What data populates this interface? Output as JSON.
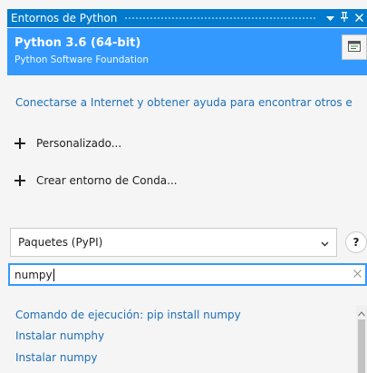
{
  "window": {
    "title": "Entornos de Python",
    "pin_glyph": "Ѩ",
    "menu_glyph": "▾",
    "close_glyph": "✕"
  },
  "environment": {
    "name": "Python 3.6 (64-bit)",
    "vendor": "Python Software Foundation",
    "open_icon": "console-window-icon"
  },
  "help_link": "Conectarse a Internet y obtener ayuda para encontrar otros e",
  "actions": [
    {
      "label": "Personalizado...",
      "icon": "plus-icon"
    },
    {
      "label": "Crear entorno de Conda...",
      "icon": "plus-icon"
    }
  ],
  "view_selector": {
    "selected": "Paquetes (PyPI)",
    "help_label": "?"
  },
  "search": {
    "value": "numpy",
    "clear_glyph": "✕"
  },
  "results": [
    "Comando de ejecución: pip install numpy",
    "Instalar numphy",
    "Instalar numpy"
  ],
  "colors": {
    "accent": "#007acc",
    "selection": "#3399ff",
    "link": "#1e6fb8"
  }
}
